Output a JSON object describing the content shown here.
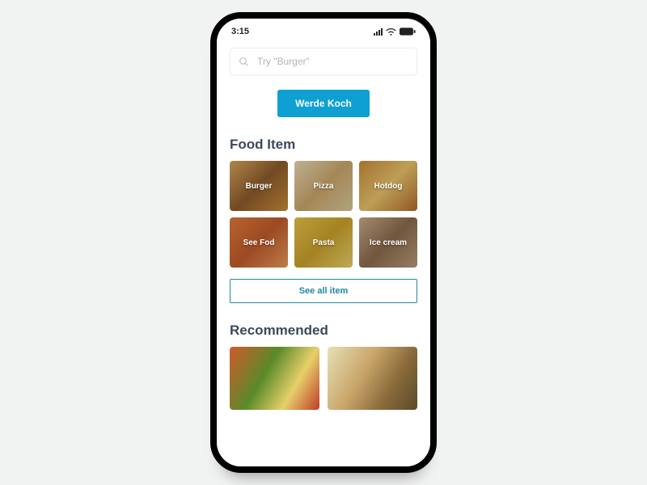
{
  "status": {
    "time": "3:15"
  },
  "search": {
    "placeholder": "Try \"Burger\""
  },
  "cta": {
    "label": "Werde Koch"
  },
  "sections": {
    "food": {
      "title": "Food Item",
      "items": [
        {
          "label": "Burger"
        },
        {
          "label": "Pizza"
        },
        {
          "label": "Hotdog"
        },
        {
          "label": "See Fod"
        },
        {
          "label": "Pasta"
        },
        {
          "label": "Ice cream"
        }
      ],
      "see_all_label": "See all item"
    },
    "recommended": {
      "title": "Recommended"
    }
  }
}
